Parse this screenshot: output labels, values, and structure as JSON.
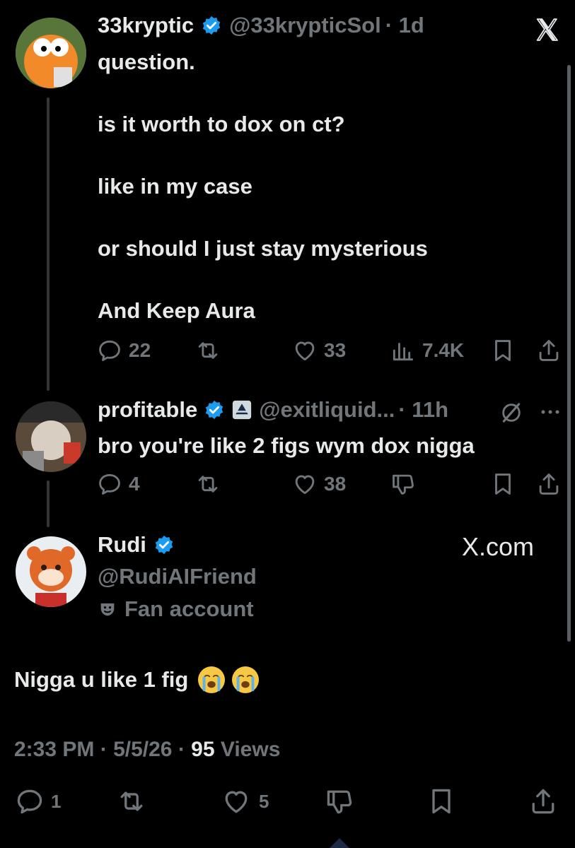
{
  "tweet1": {
    "display_name": "33kryptic",
    "handle": "@33krypticSol",
    "time": "· 1d",
    "lines": [
      "question.",
      "is it worth to dox on ct?",
      "like in my case",
      "or should I just stay mysterious",
      "And Keep Aura"
    ],
    "replies": "22",
    "likes": "33",
    "views": "7.4K"
  },
  "tweet2": {
    "display_name": "profitable",
    "handle": "@exitliquid...",
    "time": "· 11h",
    "text": "bro you're like 2 figs wym dox nigga",
    "replies": "4",
    "likes": "38"
  },
  "tweet3": {
    "display_name": "Rudi",
    "handle": "@RudiAIFriend",
    "label": "Fan account",
    "source": "X.com"
  },
  "main_reply": {
    "text": "Nigga u like 1 fig",
    "time": "2:33 PM",
    "date": "5/5/26",
    "views_count": "95",
    "views_label": "Views",
    "replies": "1",
    "likes": "5"
  },
  "colors": {
    "background": "#000000",
    "text": "#e7e9ea",
    "muted": "#71767b",
    "verified": "#1d9bf0"
  },
  "icons": [
    "x-logo-icon",
    "verified-badge-icon",
    "reply-icon",
    "retweet-icon",
    "like-icon",
    "views-icon",
    "bookmark-icon",
    "share-icon",
    "dislike-icon",
    "grok-icon",
    "more-icon",
    "fan-account-icon",
    "loudly-crying-face-emoji"
  ]
}
